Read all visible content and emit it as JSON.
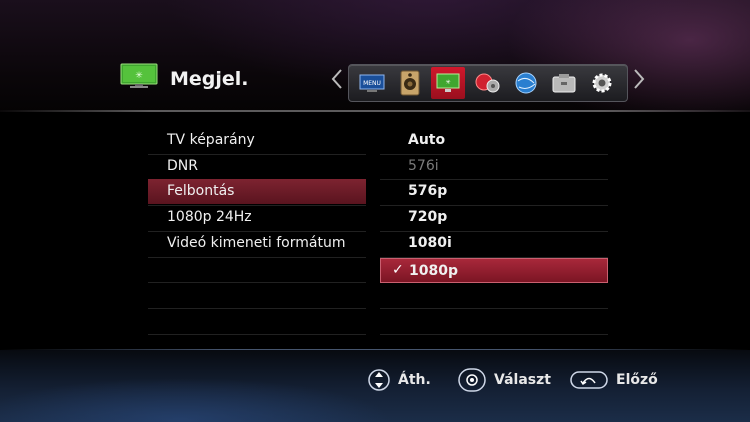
{
  "header": {
    "title": "Megjel.",
    "icons": [
      {
        "name": "disc-menu-icon",
        "active": false
      },
      {
        "name": "speaker-audio-icon",
        "active": false
      },
      {
        "name": "display-tv-icon",
        "active": true
      },
      {
        "name": "lock-gear-icon",
        "active": false
      },
      {
        "name": "network-globe-icon",
        "active": false
      },
      {
        "name": "folder-other-icon",
        "active": false
      },
      {
        "name": "gear-settings-icon",
        "active": false
      }
    ]
  },
  "menu": {
    "items": [
      "TV képarány",
      "DNR",
      "Felbontás",
      "1080p 24Hz",
      "Videó kimeneti formátum"
    ],
    "selected_index": 2
  },
  "options": {
    "items": [
      "Auto",
      "576i",
      "576p",
      "720p",
      "1080i",
      "1080p"
    ],
    "disabled_index": 1,
    "selected_index": 5,
    "check_mark": "✓"
  },
  "footer": {
    "move_label": "Áth.",
    "select_label": "Választ",
    "back_label": "Előző"
  },
  "colors": {
    "accent_red": "#a8283a",
    "active_icon_red": "#d0182c"
  }
}
